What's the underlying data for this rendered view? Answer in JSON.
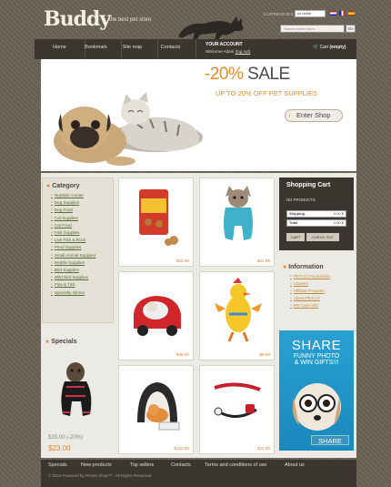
{
  "header": {
    "logo": "Buddy",
    "tagline": "the best pet store",
    "currencies_label": "CURRENCIES",
    "currency_selected": "us dollar",
    "search_placeholder": "Search entire store...",
    "go_label": "Go"
  },
  "nav": {
    "items": [
      "Home",
      "Bookmark",
      "Site map",
      "Contacts"
    ],
    "account_title": "YOUR ACCOUNT",
    "welcome": "Welcome Adam",
    "logout": "(log out)",
    "cart_label": "Cart",
    "cart_state": "(empty)"
  },
  "banner": {
    "percent": "-20%",
    "sale": "SALE",
    "subtitle": "UP TO 20% OFF PET SUPPLIES",
    "cta": "Enter Shop"
  },
  "category": {
    "title": "Category",
    "items": [
      "Nutrition Center",
      "Dog Supplies",
      "Dog Food",
      "Cat Supplies",
      "Cat Food",
      "Fish Supplies",
      "Live Fish & Rock",
      "Pond Supplies",
      "Small Animal Supplies",
      "Reptile Supplies",
      "Bird Supplies",
      "Wild Bird Supplies",
      "Flea & Tick",
      "Specialty Stores"
    ]
  },
  "specials": {
    "title": "Specials",
    "old_price": "$35.00 (-20%)",
    "new_price": "$23.00"
  },
  "products": [
    {
      "price": "$15.99",
      "icon": "treats-bag-icon"
    },
    {
      "price": "$21.99",
      "icon": "dog-outfit-icon"
    },
    {
      "price": "$48.00",
      "icon": "pet-car-bed-icon"
    },
    {
      "price": "$5.99",
      "icon": "duck-toy-icon"
    },
    {
      "price": "$122.65",
      "icon": "cat-tunnel-icon"
    },
    {
      "price": "$11.00",
      "icon": "dog-leash-icon"
    }
  ],
  "cart": {
    "title": "Shopping Cart",
    "no_products": "NO PRODUCTS",
    "shipping_label": "Shipping",
    "shipping_value": "0.00 $",
    "total_label": "Total",
    "total_value": "0.00 $",
    "cart_button": "CART",
    "checkout_button": "CHECK OUT"
  },
  "information": {
    "title": "Information",
    "items": [
      "PETCO Foundation",
      "Careers",
      "Affiliate Program",
      "About PETCO",
      "Pet Care Info"
    ]
  },
  "share": {
    "title": "SHARE",
    "line1": "FUNNY PHOTO",
    "line2": "& WIN GIFTS!!!",
    "button": "SHARE"
  },
  "footer": {
    "links": [
      "Specials",
      "New products",
      "Top sellers",
      "Contacts",
      "Terms and conditions of use",
      "About us"
    ],
    "copyright": "© 2010 Powered by Presta Shop™ . All Rights Reserved"
  },
  "colors": {
    "accent": "#e98a2c",
    "dark": "#3b362f",
    "bg": "#6b6559"
  }
}
